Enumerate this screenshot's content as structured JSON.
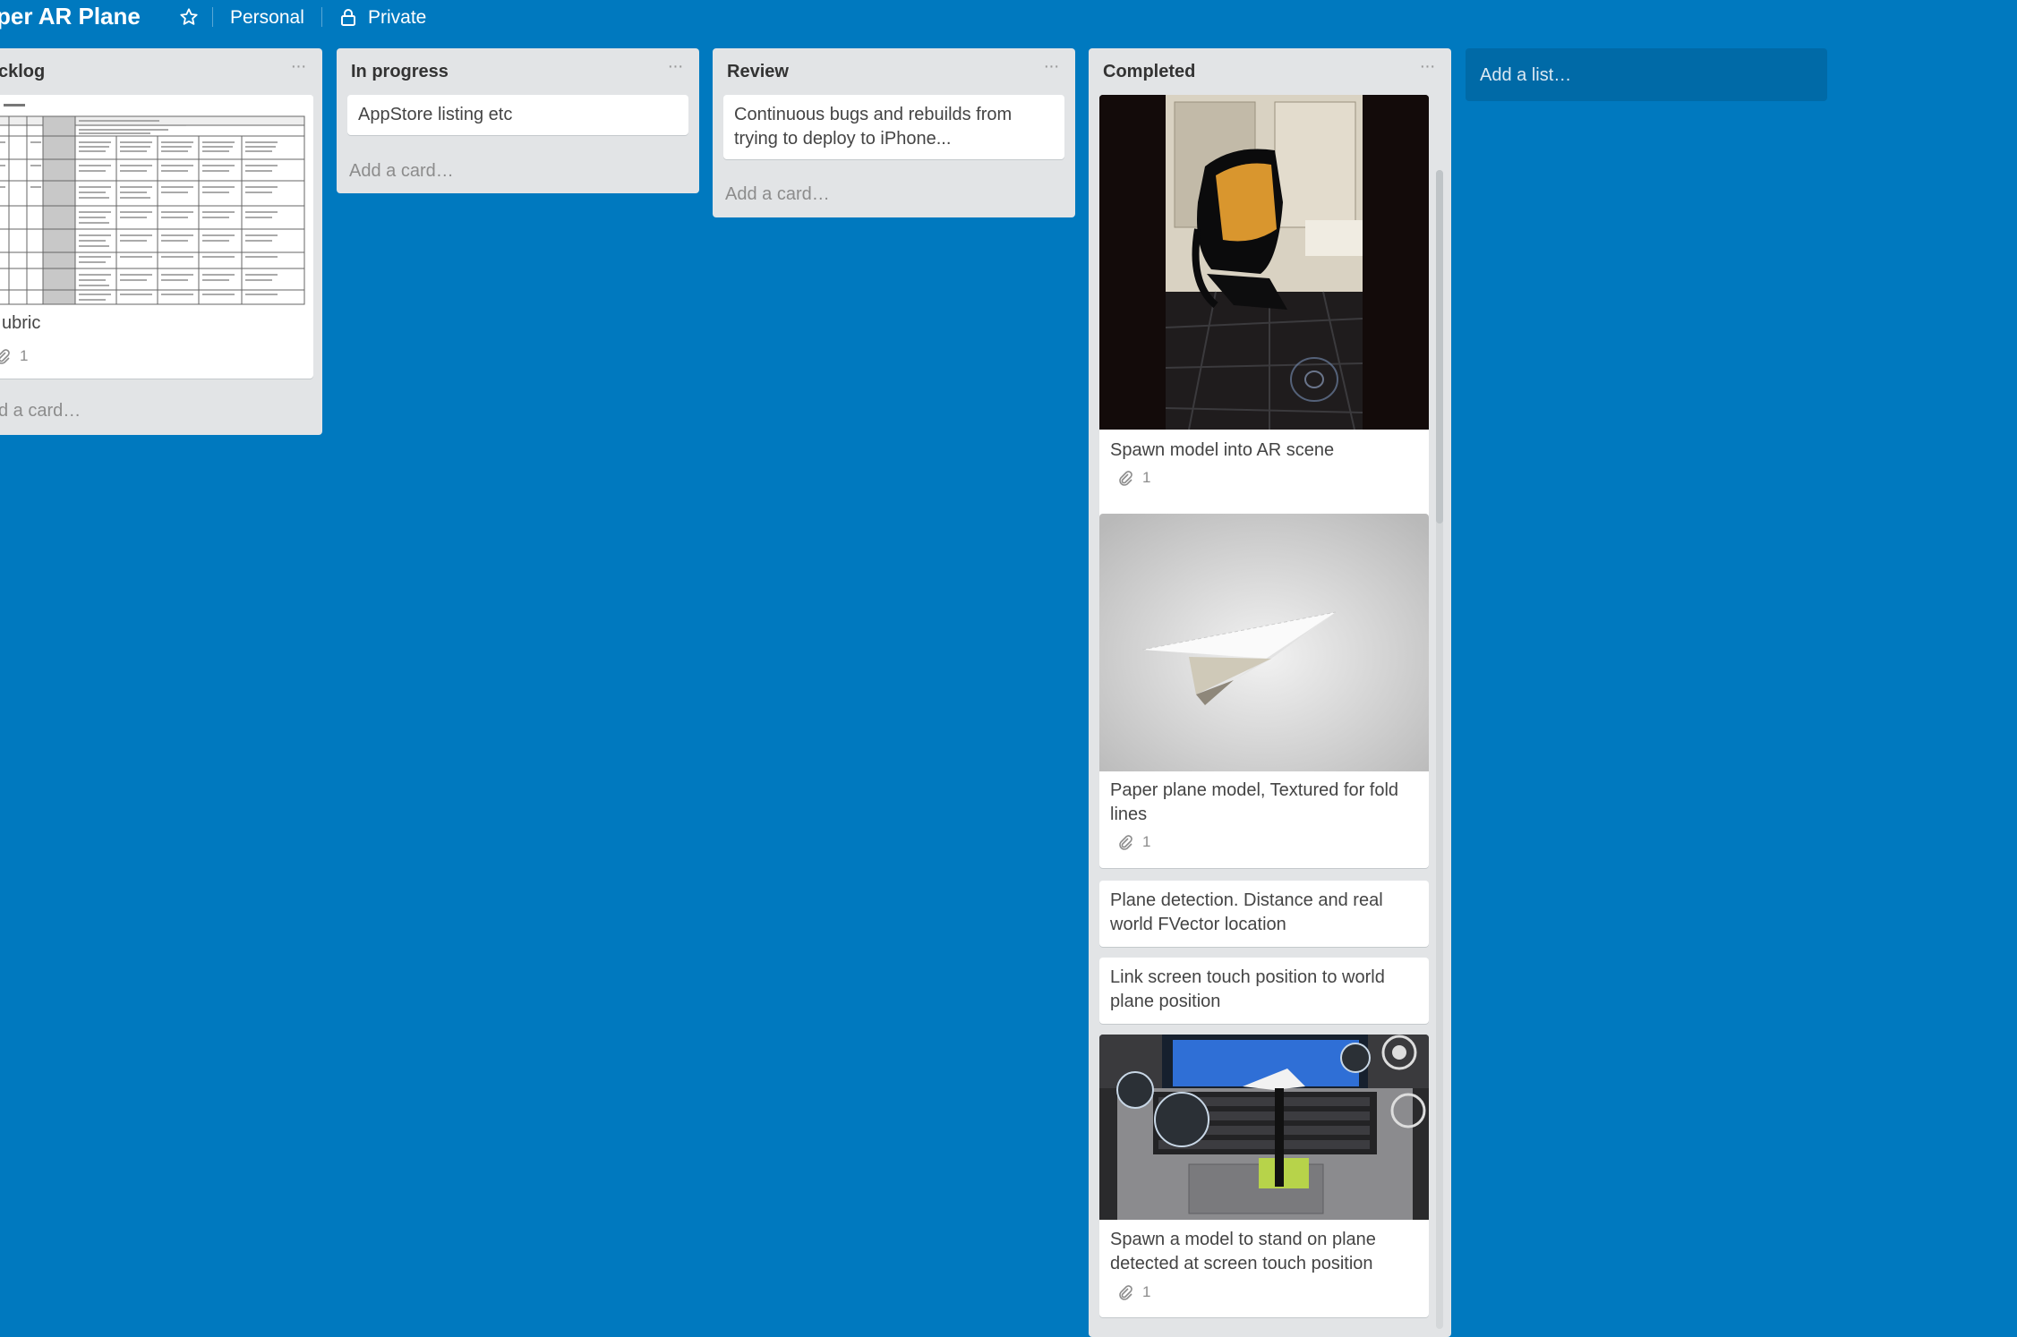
{
  "header": {
    "title": "per AR Plane",
    "star_icon": "star-icon",
    "team": "Personal",
    "visibility_icon": "lock-icon",
    "visibility": "Private"
  },
  "lists": [
    {
      "title": "cklog",
      "cards": [
        {
          "title": "ubric",
          "attachments": "1",
          "cover": "rubric-document-image"
        }
      ],
      "add_card": "d a card…"
    },
    {
      "title": "In progress",
      "cards": [
        {
          "title": "AppStore listing etc"
        }
      ],
      "add_card": "Add a card…"
    },
    {
      "title": "Review",
      "cards": [
        {
          "title": "Continuous bugs and rebuilds from trying to deploy to iPhone..."
        }
      ],
      "add_card": "Add a card…"
    },
    {
      "title": "Completed",
      "cards": [
        {
          "title": "Spawn model into AR scene",
          "attachments": "1",
          "cover": "ar-chair-photo"
        },
        {
          "title": "Paper plane model, Textured for fold lines",
          "attachments": "1",
          "cover": "paper-plane-render"
        },
        {
          "title": "Plane detection. Distance and real world FVector location"
        },
        {
          "title": "Link screen touch position to world plane position"
        },
        {
          "title": "Spawn a model to stand on plane detected at screen touch position",
          "attachments": "1",
          "cover": "laptop-ar-photo"
        }
      ]
    }
  ],
  "add_list": "Add a list…",
  "menu_glyph": "···",
  "colors": {
    "board": "#0079bf",
    "list": "#e2e4e6",
    "add_list": "#006aa7"
  }
}
